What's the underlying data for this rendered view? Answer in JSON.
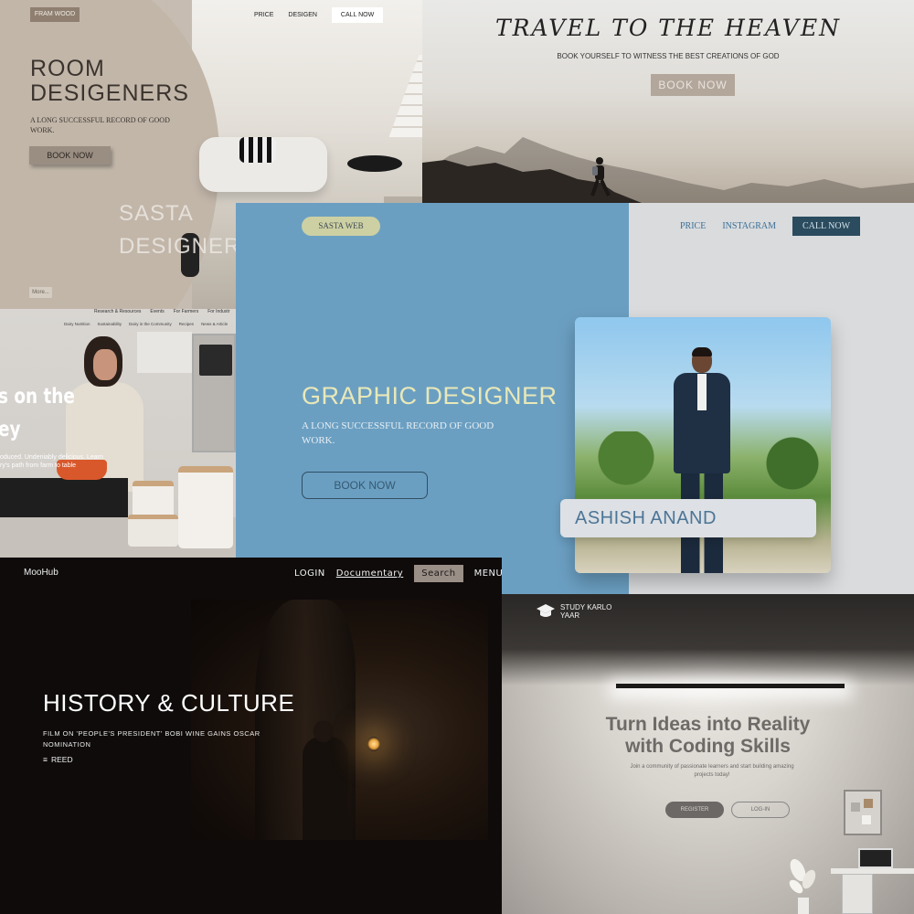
{
  "room": {
    "badge": "FRAM WOOD",
    "nav": [
      "PRICE",
      "DESIGEN"
    ],
    "call": "CALL NOW",
    "title_line1": "ROOM",
    "title_line2": "DESIGENERS",
    "subtitle": "A LONG SUCCESSFUL RECORD OF GOOD WORK.",
    "book": "BOOK NOW",
    "overlay_line1": "SASTA",
    "overlay_line2": "DESIGNERS",
    "more": "More..."
  },
  "travel": {
    "title": "TRAVEL TO THE HEAVEN",
    "subtitle": "BOOK YOURSELF TO WITNESS THE BEST CREATIONS OF GOD",
    "book": "BOOK NOW"
  },
  "kitchen": {
    "nav": [
      "Research & Resources",
      "Events",
      "For Farmers",
      "For Industr"
    ],
    "subnav": [
      "Dairy Nutrition",
      "Sustainability",
      "Dairy in the Community",
      "Recipes",
      "News & Article"
    ],
    "title": "s on the\ney",
    "description": "oduced. Undeniably delicious. Learn\nry's path from farm to table"
  },
  "graphic": {
    "brand": "SASTA WEB",
    "nav_price": "PRICE",
    "nav_instagram": "INSTAGRAM",
    "call": "CALL NOW",
    "title": "GRAPHIC DESIGNER",
    "subtitle": "A LONG SUCCESSFUL RECORD OF GOOD WORK.",
    "book": "BOOK NOW",
    "name": "ASHISH ANAND"
  },
  "moohub": {
    "logo": "MooHub",
    "login": "LOGIN",
    "documentary": "Documentary",
    "search": "Search",
    "menu": "MENU",
    "title": "HISTORY & CULTURE",
    "subtitle": "Film on 'People's President' Bobi Wine gains Oscar nomination",
    "read": "REED"
  },
  "study": {
    "logo_line1": "STUDY KARLO",
    "logo_line2": "YAAR",
    "title_line1": "Turn Ideas into Reality",
    "title_line2": "with Coding Skills",
    "subtitle": "Join a community of passionate learners and start building amazing projects today!",
    "register": "REGISTER",
    "login": "LOG-IN"
  },
  "colors": {
    "graphic_blue": "#6b9fc2",
    "graphic_accent": "#e8e8b8",
    "moohub_bg": "#0f0b0b",
    "room_beige": "#c9bfb4"
  }
}
